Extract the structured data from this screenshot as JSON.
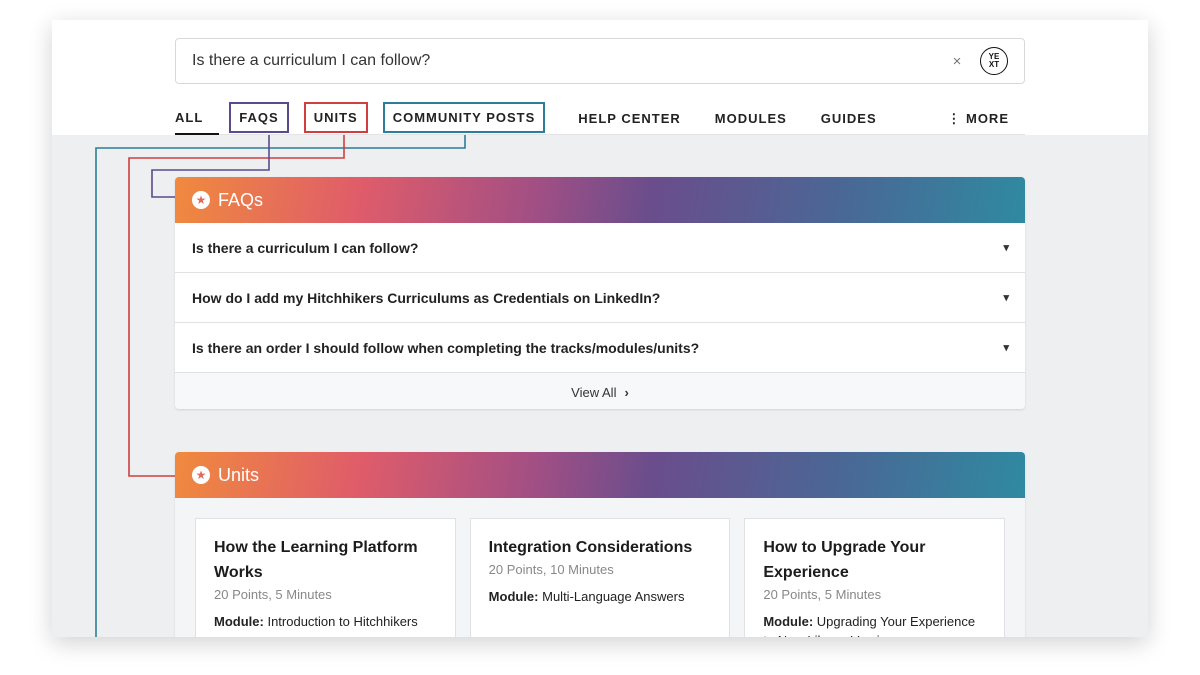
{
  "search": {
    "query": "Is there a curriculum I can follow?",
    "clear_label": "×",
    "logo_top": "YE",
    "logo_bottom": "XT"
  },
  "tabs": {
    "all": "ALL",
    "faqs": "FAQS",
    "units": "UNITS",
    "community_posts": "COMMUNITY POSTS",
    "help_center": "HELP CENTER",
    "modules": "MODULES",
    "guides": "GUIDES",
    "more": "⋮ MORE"
  },
  "faqs_section": {
    "title": "FAQs",
    "icon": "star-circle-icon",
    "items": [
      "Is there a curriculum I can follow?",
      "How do I add my Hitchhikers Curriculums as Credentials on LinkedIn?",
      "Is there an order I should follow when completing the tracks/modules/units?"
    ],
    "view_all": "View All"
  },
  "units_section": {
    "title": "Units",
    "icon": "star-circle-icon",
    "cards": [
      {
        "title": "How the Learning Platform Works",
        "meta": "20 Points, 5 Minutes",
        "module_label": "Module:",
        "module": "Introduction to Hitchhikers"
      },
      {
        "title": "Integration Considerations",
        "meta": "20 Points, 10 Minutes",
        "module_label": "Module:",
        "module": "Multi-Language Answers"
      },
      {
        "title": "How to Upgrade Your Experience",
        "meta": "20 Points, 5 Minutes",
        "module_label": "Module:",
        "module": "Upgrading Your Experience to New Library Version"
      }
    ]
  },
  "colors": {
    "faqs_outline": "#5b4a8b",
    "units_outline": "#cf3f3f",
    "posts_outline": "#2c7d99"
  }
}
